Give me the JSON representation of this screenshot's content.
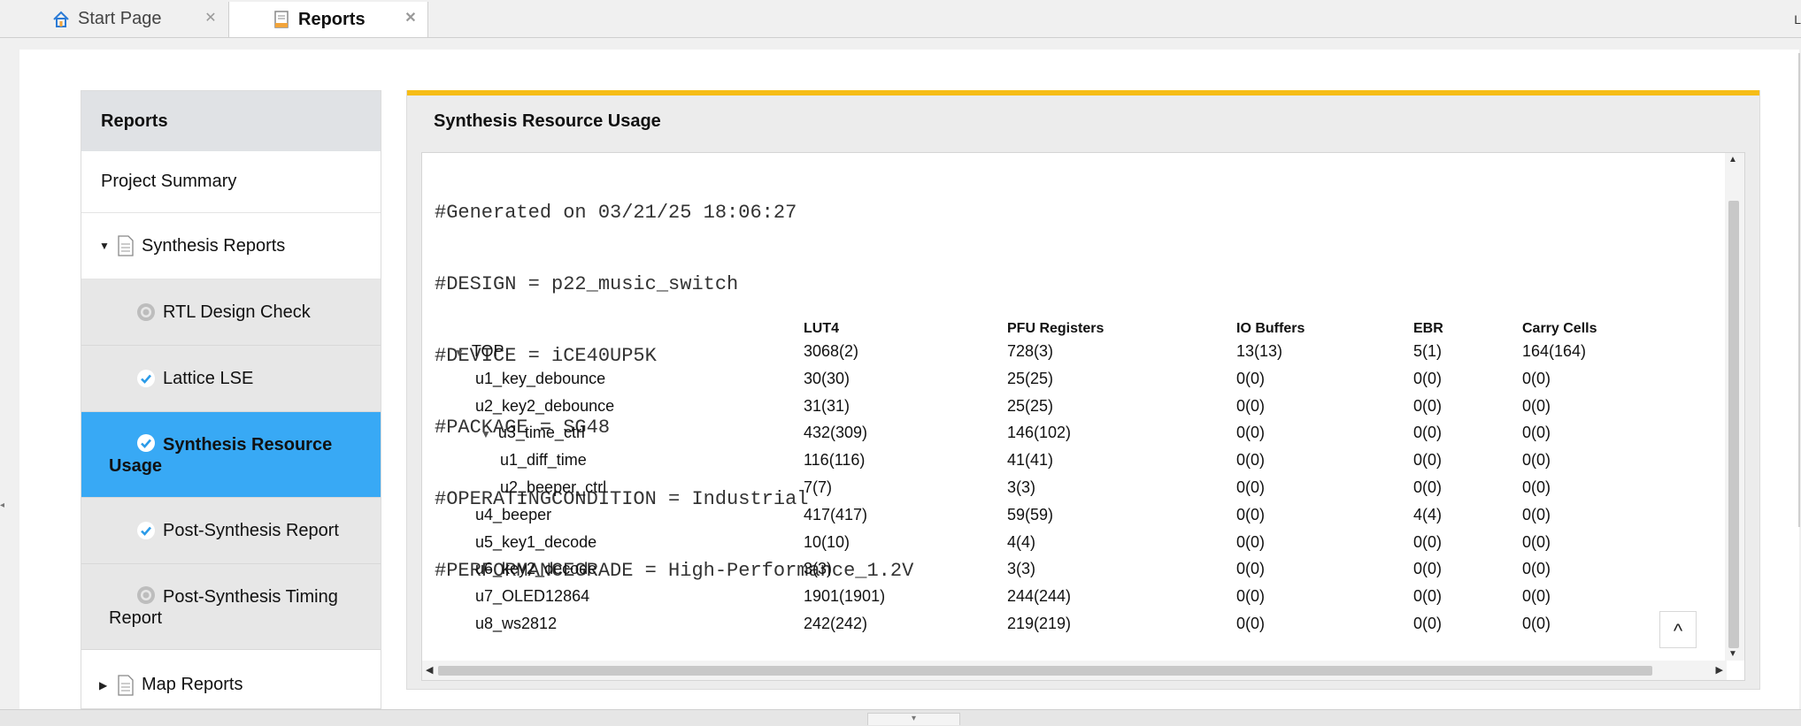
{
  "tabs": [
    {
      "label": "Start Page",
      "icon": "home-icon",
      "active": false
    },
    {
      "label": "Reports",
      "icon": "report-doc-icon",
      "active": true
    }
  ],
  "nav": {
    "header": "Reports",
    "items": [
      {
        "label": "Project Summary"
      },
      {
        "label": "Synthesis Reports",
        "expanded": true,
        "icon": "document-icon"
      },
      {
        "label": "RTL Design Check",
        "status": "pending-icon"
      },
      {
        "label": "Lattice LSE",
        "status": "check-icon"
      },
      {
        "label": "Synthesis Resource Usage",
        "label_line1": "Synthesis Resource",
        "label_line2": "Usage",
        "status": "check-icon",
        "selected": true
      },
      {
        "label": "Post-Synthesis Report",
        "status": "check-icon"
      },
      {
        "label": "Post-Synthesis Timing Report",
        "label_line1": "Post-Synthesis Timing",
        "label_line2": "Report",
        "status": "pending-icon"
      },
      {
        "label": "Map Reports",
        "expanded": false,
        "icon": "document-icon"
      }
    ]
  },
  "report": {
    "title": "Synthesis Resource Usage",
    "accent_color": "#f6bd16",
    "header_lines": [
      "#Generated on 03/21/25 18:06:27",
      "#DESIGN = p22_music_switch",
      "#DEVICE = iCE40UP5K",
      "#PACKAGE = SG48",
      "#OPERATINGCONDITION = Industrial",
      "#PERFORMANCEGRADE = High-Performance_1.2V"
    ],
    "columns": [
      "LUT4",
      "PFU Registers",
      "IO Buffers",
      "EBR",
      "Carry Cells"
    ],
    "rows": [
      {
        "name": "TOP",
        "lut4": "3068(2)",
        "pfu": "728(3)",
        "io": "13(13)",
        "ebr": "5(1)",
        "carry": "164(164)"
      },
      {
        "name": "u1_key_debounce",
        "lut4": "30(30)",
        "pfu": "25(25)",
        "io": "0(0)",
        "ebr": "0(0)",
        "carry": "0(0)"
      },
      {
        "name": "u2_key2_debounce",
        "lut4": "31(31)",
        "pfu": "25(25)",
        "io": "0(0)",
        "ebr": "0(0)",
        "carry": "0(0)"
      },
      {
        "name": "u3_time_ctrl",
        "lut4": "432(309)",
        "pfu": "146(102)",
        "io": "0(0)",
        "ebr": "0(0)",
        "carry": "0(0)"
      },
      {
        "name": "u1_diff_time",
        "lut4": "116(116)",
        "pfu": "41(41)",
        "io": "0(0)",
        "ebr": "0(0)",
        "carry": "0(0)"
      },
      {
        "name": "u2_beeper_ctrl",
        "lut4": "7(7)",
        "pfu": "3(3)",
        "io": "0(0)",
        "ebr": "0(0)",
        "carry": "0(0)"
      },
      {
        "name": "u4_beeper",
        "lut4": "417(417)",
        "pfu": "59(59)",
        "io": "0(0)",
        "ebr": "4(4)",
        "carry": "0(0)"
      },
      {
        "name": "u5_key1_decode",
        "lut4": "10(10)",
        "pfu": "4(4)",
        "io": "0(0)",
        "ebr": "0(0)",
        "carry": "0(0)"
      },
      {
        "name": "u6_key2_decode",
        "lut4": "3(3)",
        "pfu": "3(3)",
        "io": "0(0)",
        "ebr": "0(0)",
        "carry": "0(0)"
      },
      {
        "name": "u7_OLED12864",
        "lut4": "1901(1901)",
        "pfu": "244(244)",
        "io": "0(0)",
        "ebr": "0(0)",
        "carry": "0(0)"
      },
      {
        "name": "u8_ws2812",
        "lut4": "242(242)",
        "pfu": "219(219)",
        "io": "0(0)",
        "ebr": "0(0)",
        "carry": "0(0)"
      }
    ],
    "scroll_top_label": "^"
  },
  "colors": {
    "selected_bg": "#38a9f5",
    "nav_header_bg": "#e0e2e5",
    "sub_item_bg": "#e7e7e7",
    "check_color": "#2b9be8"
  }
}
